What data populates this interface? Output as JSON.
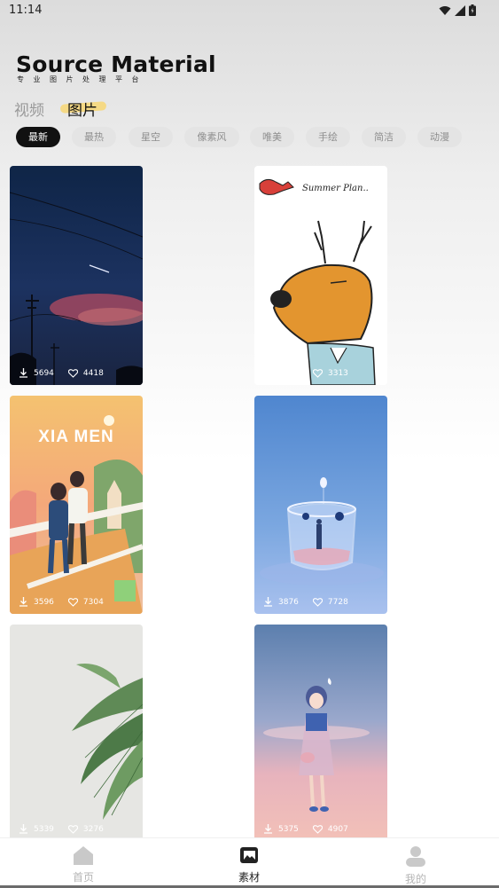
{
  "status": {
    "time": "11:14"
  },
  "header": {
    "title": "Source Material",
    "subtitle": "专业图片处理平台"
  },
  "tabs": {
    "video": "视频",
    "image": "图片"
  },
  "chips": [
    "最新",
    "最热",
    "星空",
    "像素风",
    "唯美",
    "手绘",
    "简洁",
    "动漫"
  ],
  "cards": [
    {
      "downloads": "5694",
      "likes": "4418"
    },
    {
      "downloads": "",
      "likes": "3313"
    },
    {
      "downloads": "3596",
      "likes": "7304"
    },
    {
      "downloads": "3876",
      "likes": "7728"
    },
    {
      "downloads": "5339",
      "likes": "3276"
    },
    {
      "downloads": "5375",
      "likes": "4907"
    }
  ],
  "card_texts": {
    "summer": "Summer Plan..",
    "city": "XIA MEN"
  },
  "bottom_nav": {
    "home": "首页",
    "material": "素材",
    "mine": "我的"
  },
  "colors": {
    "active_chip": "#111111",
    "accent_underline": "#f5d985"
  }
}
